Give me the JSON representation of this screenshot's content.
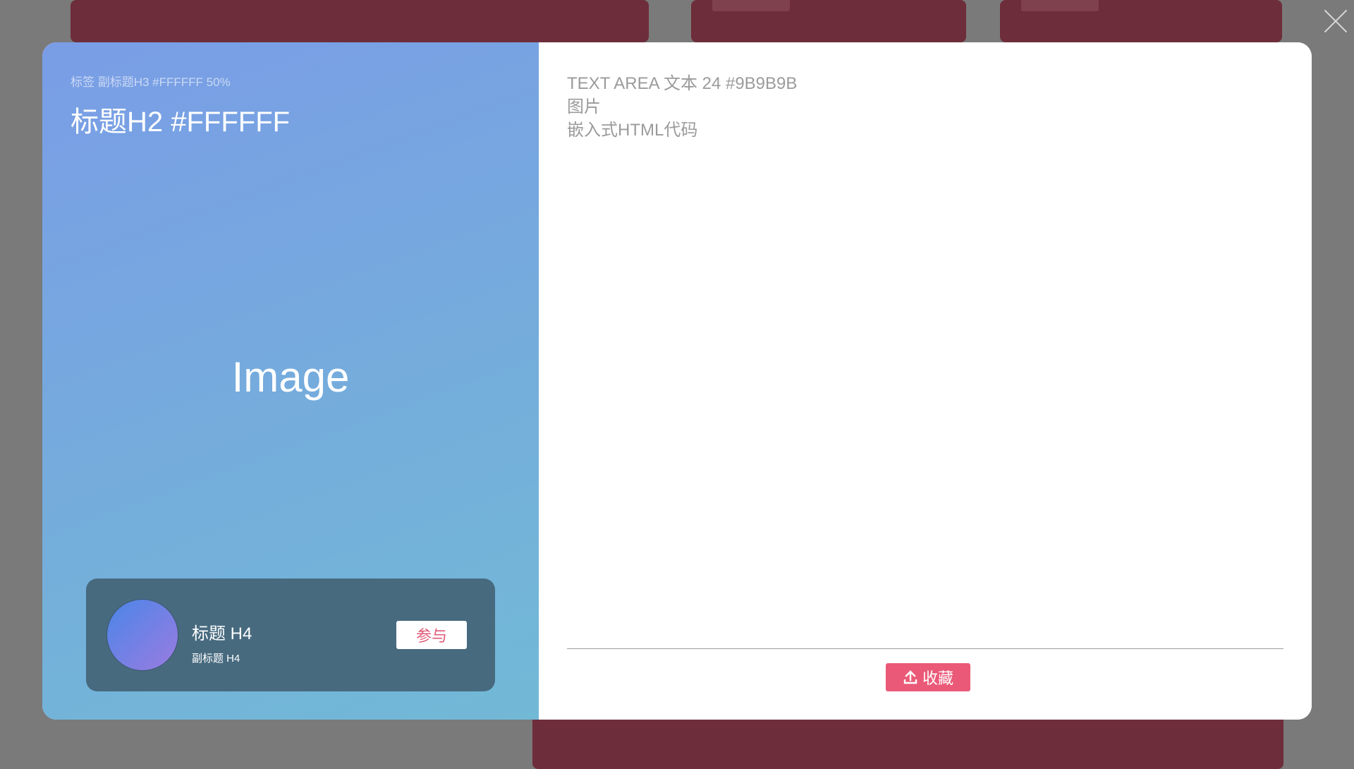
{
  "close": {
    "icon": "close-icon"
  },
  "modal": {
    "left": {
      "tag_line": "标签 副标题H3 #FFFFFF 50%",
      "title": "标题H2 #FFFFFF",
      "image_placeholder": "Image",
      "profile": {
        "title": "标题 H4",
        "subtitle": "副标题 H4",
        "join_label": "参与"
      }
    },
    "right": {
      "text_lines": [
        "TEXT AREA 文本 24 #9B9B9B",
        "图片",
        "嵌入式HTML代码"
      ],
      "favorite_label": "收藏",
      "favorite_icon": "upload-icon"
    }
  },
  "colors": {
    "accent": "#EA5A78",
    "text_area": "#9B9B9B",
    "profile_card": "#476A7F"
  }
}
